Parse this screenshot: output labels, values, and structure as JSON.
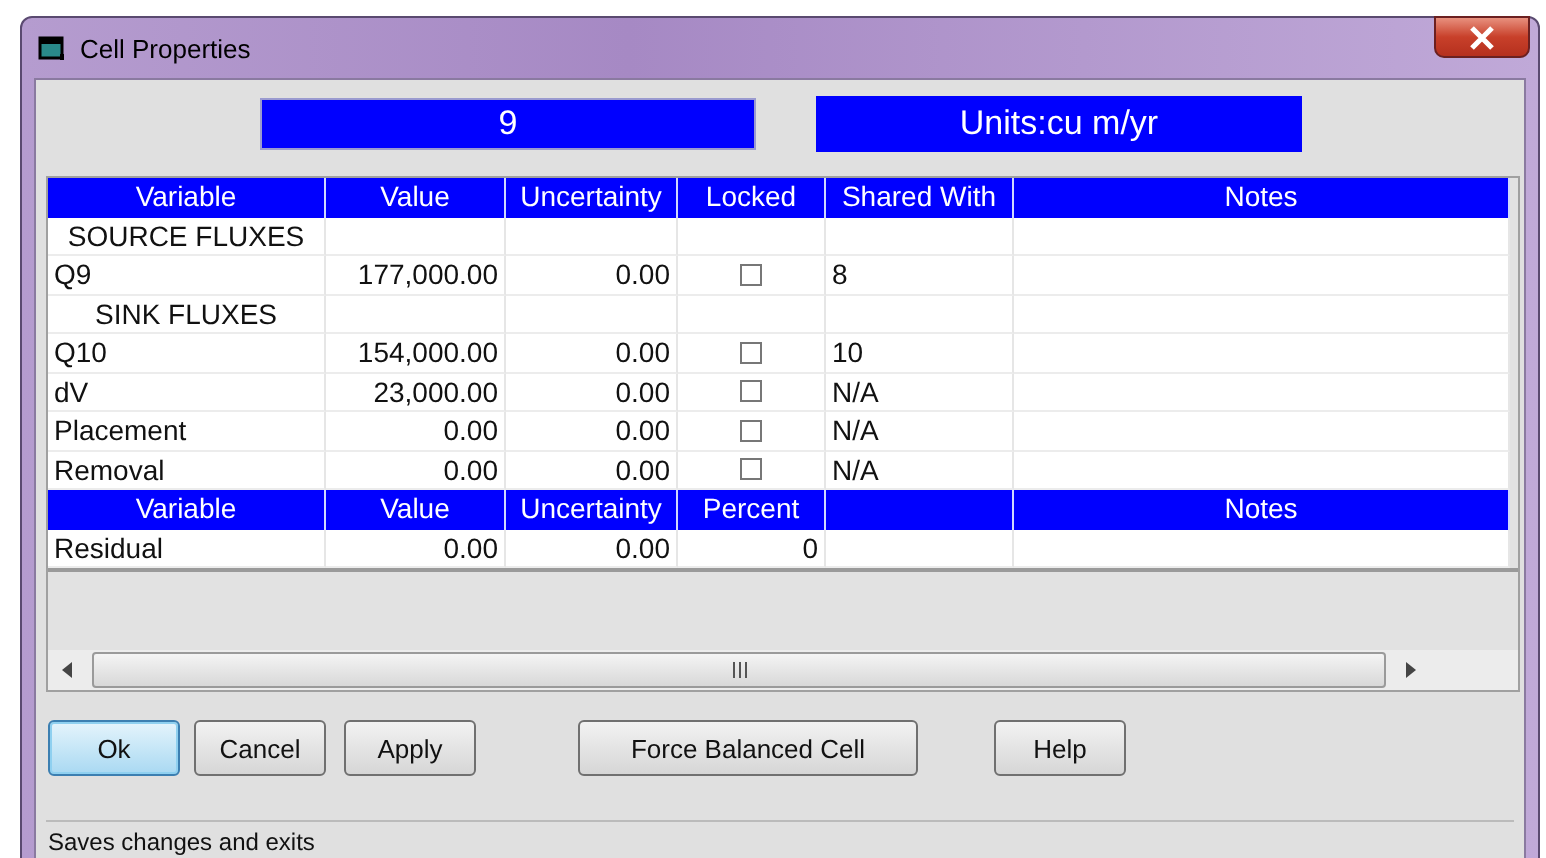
{
  "window": {
    "title": "Cell Properties"
  },
  "cell_id": "9",
  "units": "Units:cu m/yr",
  "flux_table": {
    "columns": [
      "Variable",
      "Value",
      "Uncertainty",
      "Locked",
      "Shared With",
      "Notes"
    ],
    "rows": [
      {
        "kind": "section",
        "label": "SOURCE FLUXES"
      },
      {
        "kind": "flux",
        "variable": "Q9",
        "value": "177,000.00",
        "uncertainty": "0.00",
        "locked": false,
        "shared_with": "8"
      },
      {
        "kind": "section",
        "label": "SINK FLUXES"
      },
      {
        "kind": "flux",
        "variable": "Q10",
        "value": "154,000.00",
        "uncertainty": "0.00",
        "locked": false,
        "shared_with": "10"
      },
      {
        "kind": "flux",
        "variable": "dV",
        "value": "23,000.00",
        "uncertainty": "0.00",
        "locked": false,
        "shared_with": "N/A"
      },
      {
        "kind": "flux",
        "variable": "Placement",
        "value": "0.00",
        "uncertainty": "0.00",
        "locked": false,
        "shared_with": "N/A"
      },
      {
        "kind": "flux",
        "variable": "Removal",
        "value": "0.00",
        "uncertainty": "0.00",
        "locked": false,
        "shared_with": "N/A"
      }
    ]
  },
  "residual_table": {
    "columns": [
      {
        "label": "Variable"
      },
      {
        "label": "Value"
      },
      {
        "label": "Uncertainty"
      },
      {
        "label": "Percent"
      },
      {},
      {
        "label": "Notes"
      }
    ],
    "rows": [
      {
        "variable": "Residual",
        "value": "0.00",
        "uncertainty": "0.00",
        "percent": "0"
      }
    ]
  },
  "buttons": [
    {
      "label": "Ok",
      "default": true
    },
    {
      "label": "Cancel",
      "default": false
    },
    {
      "label": "Apply",
      "default": false
    },
    {
      "label": "Force Balanced Cell",
      "default": false
    },
    {
      "label": "Help",
      "default": false
    }
  ],
  "status_bar": "Saves changes and exits"
}
